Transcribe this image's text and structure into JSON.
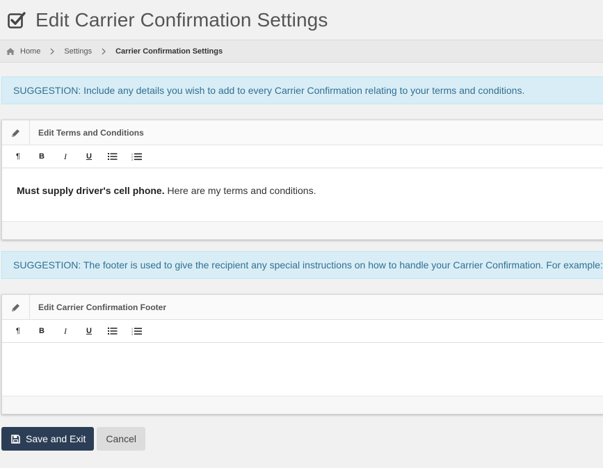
{
  "header": {
    "title": "Edit Carrier Confirmation Settings",
    "icon": "check-square-icon"
  },
  "breadcrumb": {
    "home": "Home",
    "settings": "Settings",
    "current": "Carrier Confirmation Settings"
  },
  "suggestion1": "SUGGESTION: Include any details you wish to add to every Carrier Confirmation relating to your terms and conditions.",
  "suggestion2": "SUGGESTION: The footer is used to give the recipient any special instructions on how to handle your Carrier Confirmation. For example:",
  "terms_panel": {
    "title": "Edit Terms and Conditions",
    "content_bold": "Must supply driver's cell phone.",
    "content_rest": " Here are my terms and conditions."
  },
  "footer_panel": {
    "title": "Edit Carrier Confirmation Footer",
    "content": ""
  },
  "toolbar": {
    "paragraph": "¶",
    "bold": "B",
    "italic": "I",
    "underline": "U"
  },
  "buttons": {
    "save": "Save and Exit",
    "cancel": "Cancel"
  },
  "colors": {
    "primary": "#2c3e56",
    "suggestion_bg": "#d9edf7",
    "suggestion_text": "#31708f"
  }
}
